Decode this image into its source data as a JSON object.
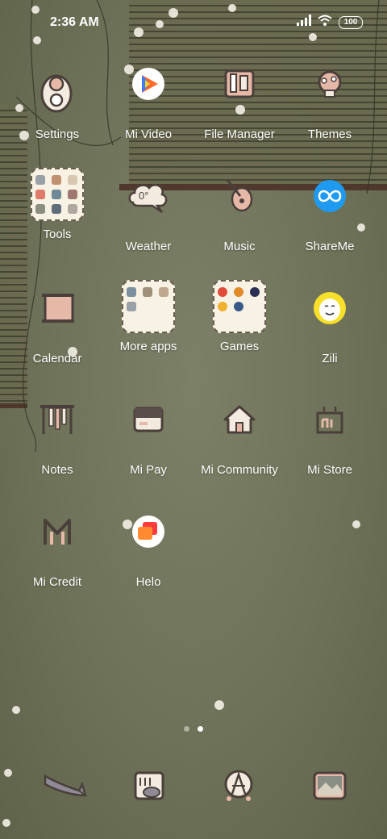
{
  "status_bar": {
    "time": "2:36 AM",
    "battery": "100"
  },
  "apps": [
    {
      "label": "Settings"
    },
    {
      "label": "Mi Video"
    },
    {
      "label": "File Manager"
    },
    {
      "label": "Themes"
    },
    {
      "label": "Tools"
    },
    {
      "label": "Weather",
      "temp": "0°"
    },
    {
      "label": "Music"
    },
    {
      "label": "ShareMe"
    },
    {
      "label": "Calendar"
    },
    {
      "label": "More apps"
    },
    {
      "label": "Games"
    },
    {
      "label": "Zili"
    },
    {
      "label": "Notes"
    },
    {
      "label": "Mi Pay"
    },
    {
      "label": "Mi Community"
    },
    {
      "label": "Mi Store"
    },
    {
      "label": "Mi Credit"
    },
    {
      "label": "Helo"
    }
  ],
  "pages": {
    "count": 2,
    "active": 2
  },
  "colors": {
    "accent": "#1e9bf0",
    "icon_outline": "#4a3f3a",
    "icon_pink": "#e6b8a8"
  },
  "icons": [
    "pen-icon",
    "fish-icon",
    "compass-icon",
    "gallery-icon"
  ]
}
